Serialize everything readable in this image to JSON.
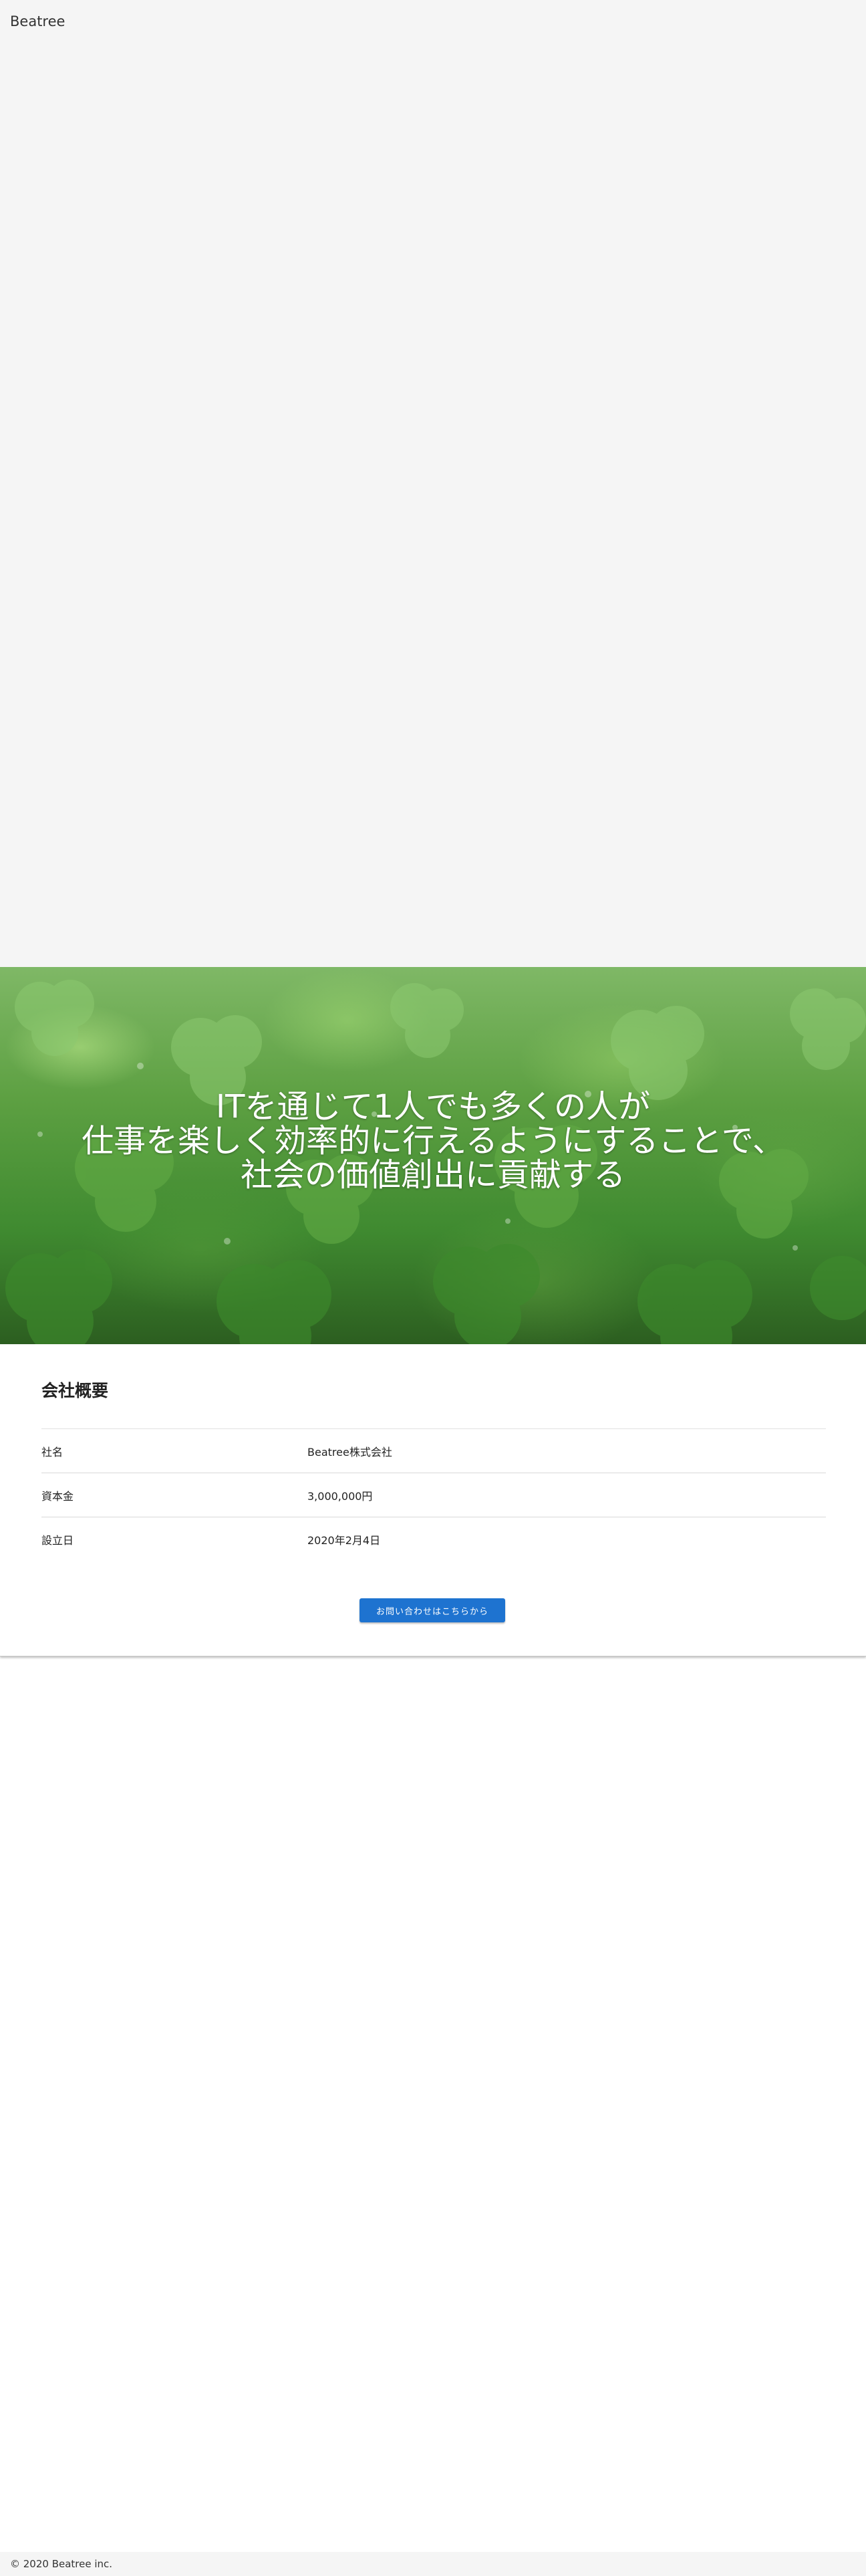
{
  "header": {
    "brand": "Beatree"
  },
  "hero": {
    "lines": [
      "ITを通じて1人でも多くの人が",
      "仕事を楽しく効率的に行えるようにすることで、",
      "社会の価値創出に貢献する"
    ]
  },
  "company": {
    "title": "会社概要",
    "rows": [
      {
        "label": "社名",
        "value": "Beatree株式会社"
      },
      {
        "label": "資本金",
        "value": "3,000,000円"
      },
      {
        "label": "設立日",
        "value": "2020年2月4日"
      }
    ],
    "contact_button": "お問い合わせはこちらから"
  },
  "footer": {
    "copyright": "© 2020 Beatree inc."
  },
  "colors": {
    "page_background": "#f5f5f5",
    "accent": "#1e73d0",
    "hero_green": "#5da042"
  }
}
